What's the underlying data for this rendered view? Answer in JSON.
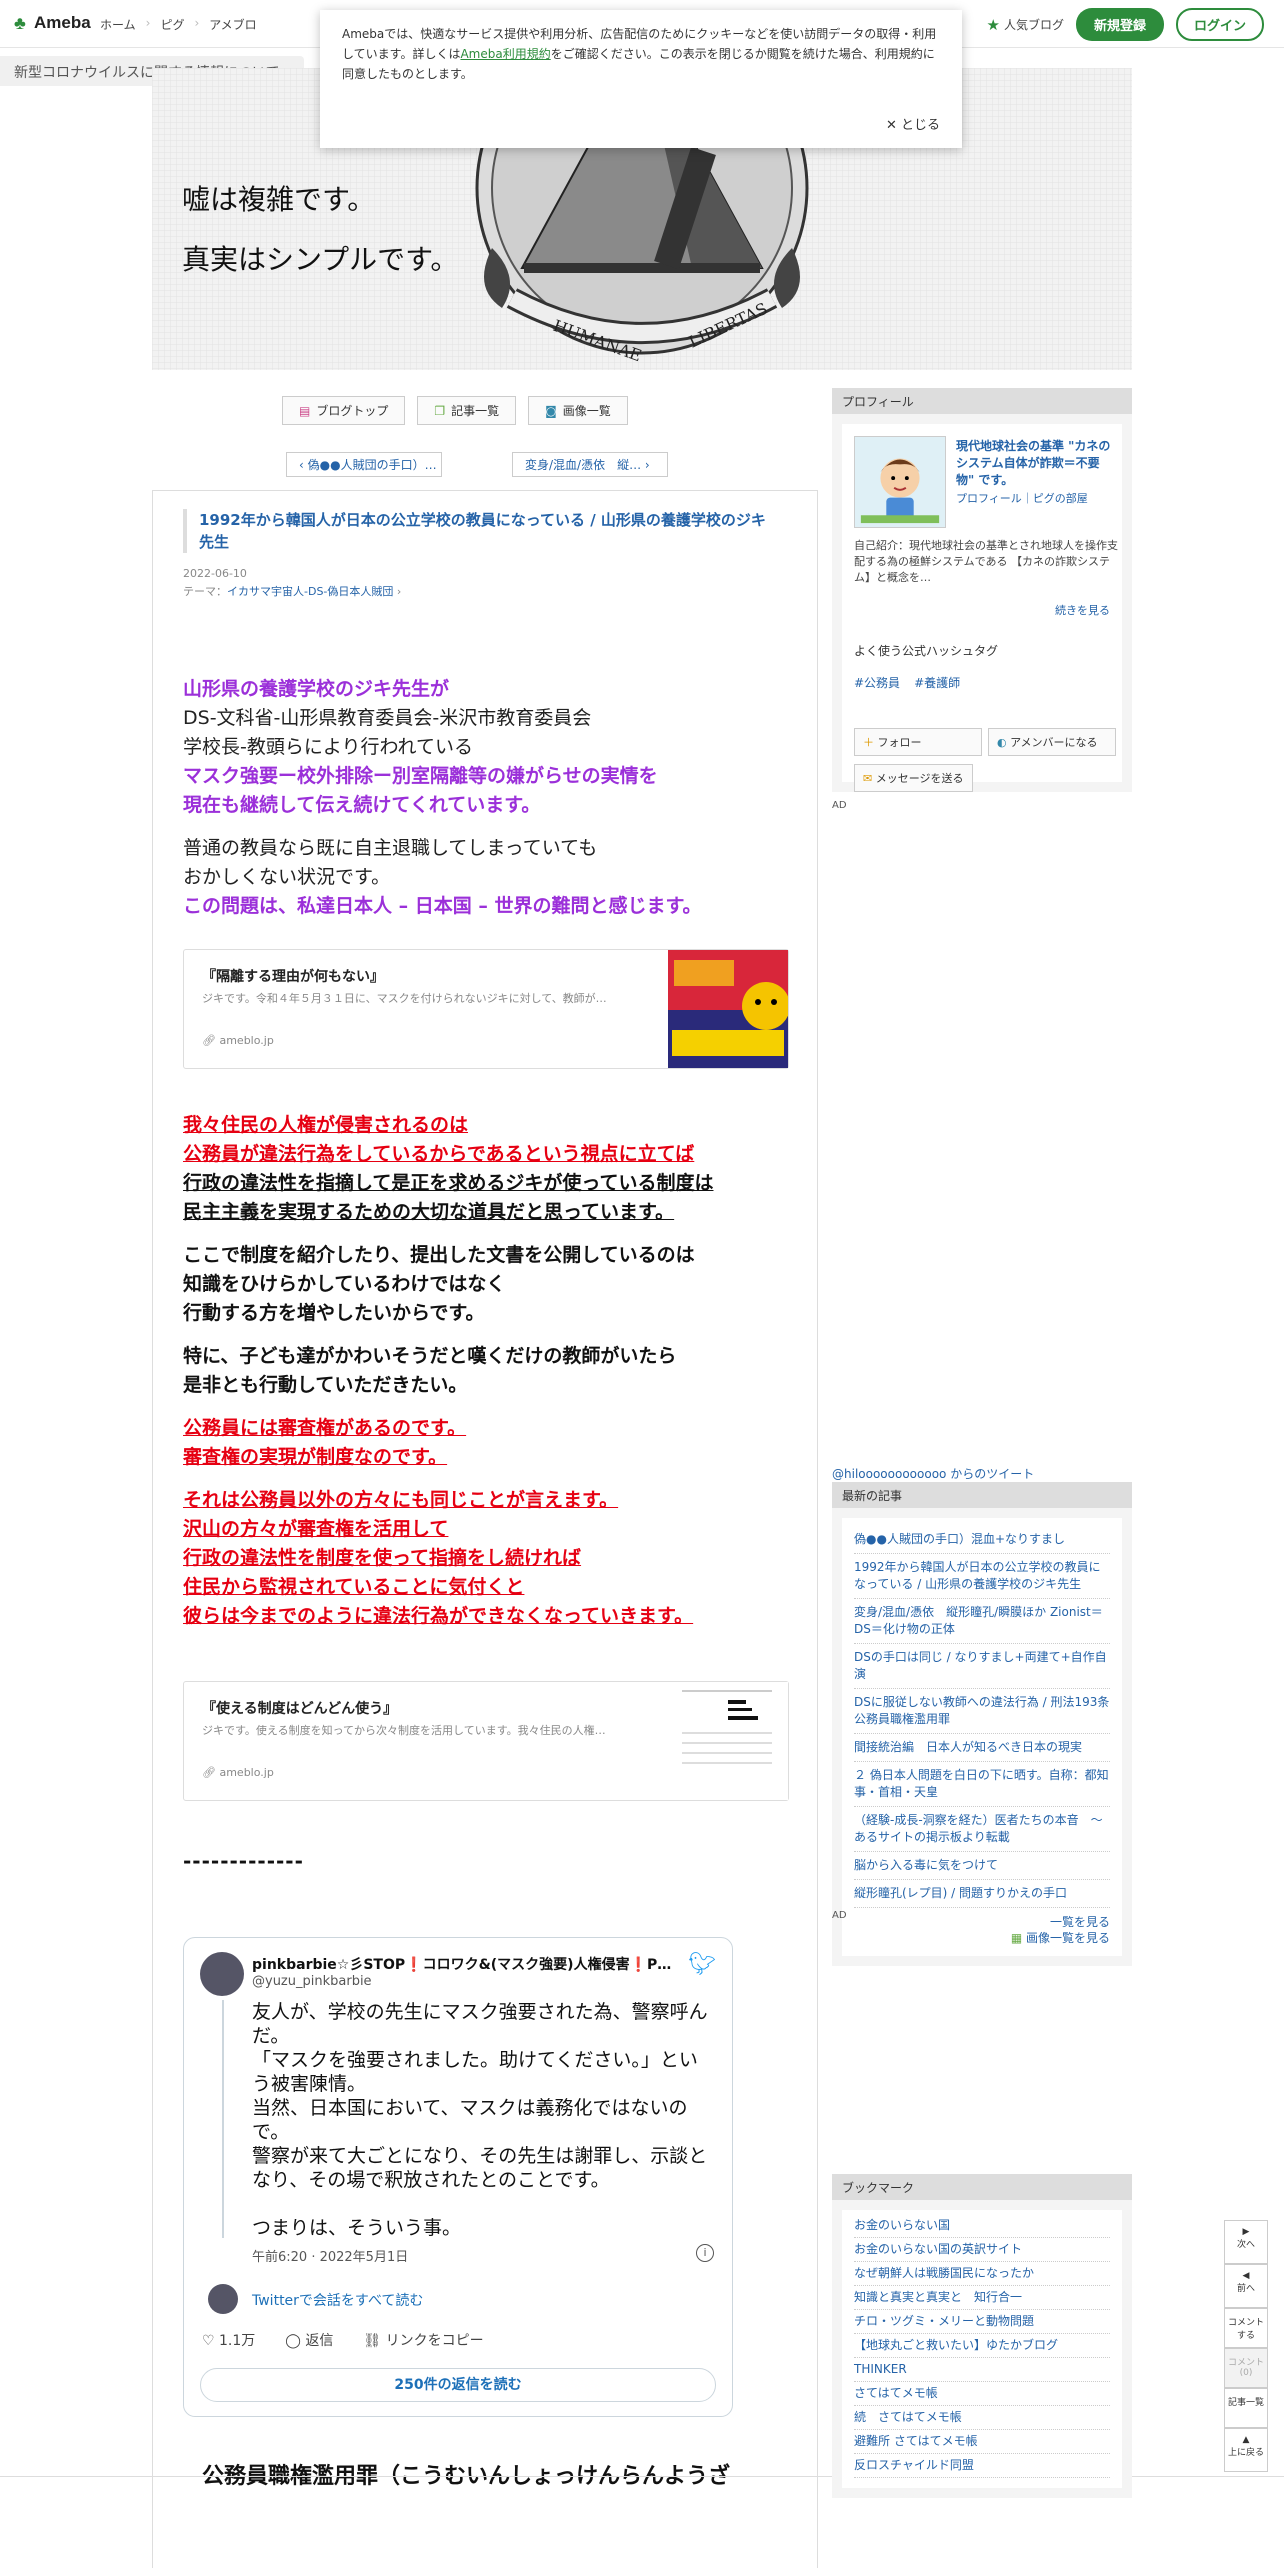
{
  "header": {
    "logo": "Ameba",
    "nav": [
      "ホーム",
      "ピグ",
      "アメブロ"
    ],
    "popular": "人気ブログ",
    "register": "新規登録",
    "login": "ログイン"
  },
  "crumb": "新型コロナウイルスに関する情報について",
  "cookie": {
    "text1": "Amebaでは、快適なサービス提供や利用分析、広告配信のためにクッキーなどを使い訪問データの取得・利用しています。詳しくは",
    "link": "Ameba利用規約",
    "text2": "をご確認ください。この表示を閉じるか閲覧を続けた場合、利用規約に同意したものとします。",
    "close": "とじる"
  },
  "banner": {
    "line1": "嘘は複雑です。",
    "line2": "真実はシンプルです。"
  },
  "blognav": [
    "ブログトップ",
    "記事一覧",
    "画像一覧"
  ],
  "pager": {
    "prev": "偽●●人賊団の手口）…",
    "next": "変身/混血/憑依　縦…"
  },
  "article": {
    "title": "1992年から韓国人が日本の公立学校の教員になっている / 山形県の養護学校のジキ先生",
    "date": "2022-06-10",
    "theme_label": "テーマ：",
    "theme": "イカサマ宇宙人-DS-偽日本人賊団",
    "p1": [
      "山形県の養護学校のジキ先生が",
      "DS-文科省-山形県教育委員会-米沢市教育委員会",
      "学校長-教頭らにより行われている",
      "マスク強要ー校外排除ー別室隔離等の嫌がらせの実情を",
      "現在も継続して伝え続けてくれています。"
    ],
    "p2": [
      "普通の教員なら既に自主退職してしまっていても",
      "おかしくない状況です。",
      "この問題は、私達日本人 – 日本国 – 世界の難問と感じます。"
    ],
    "card1": {
      "title": "『隔離する理由が何もない』",
      "desc": "ジキです。令和４年５月３１日に、マスクを付けられないジキに対して、教師が…",
      "site": "ameblo.jp"
    },
    "p3": [
      "我々住民の人権が侵害されるのは",
      "公務員が違法行為をしているからであるという視点に立てば",
      "行政の違法性を指摘して是正を求めるジキが使っている制度は",
      "民主主義を実現するための大切な道具だと思っています。"
    ],
    "p4": [
      "ここで制度を紹介したり、提出した文書を公開しているのは",
      "知識をひけらかしているわけではなく",
      "行動する方を増やしたいからです。"
    ],
    "p5": [
      "特に、子ども達がかわいそうだと嘆くだけの教師がいたら",
      "是非とも行動していただきたい。"
    ],
    "p6": [
      "公務員には審査権があるのです。",
      "審査権の実現が制度なのです。"
    ],
    "p7": [
      "それは公務員以外の方々にも同じことが言えます。",
      "沢山の方々が審査権を活用して",
      "行政の違法性を制度を使って指摘をし続ければ",
      "住民から監視されていることに気付くと",
      "彼らは今までのように違法行為ができなくなっていきます。"
    ],
    "card2": {
      "title": "『使える制度はどんどん使う』",
      "desc": "ジキです。使える制度を知ってから次々制度を活用しています。我々住民の人権…",
      "site": "ameblo.jp"
    },
    "dashes": "-------------",
    "bottom": "公務員職権濫用罪（こうむいんしょっけんらんようざ"
  },
  "tweet": {
    "name": "pinkbarbie☆彡STOP❗コロワク&(マスク強要)人権侵害❗P…",
    "handle": "@yuzu_pinkbarbie",
    "text": "友人が、学校の先生にマスク強要された為、警察呼んだ。\n「マスクを強要されました。助けてください。」という被害陳情。\n当然、日本国において、マスクは義務化ではないので。\n警察が来て大ごとになり、その先生は謝罪し、示談となり、その場で釈放されたとのことです。\n\nつまりは、そういう事。",
    "time": "午前6:20 · 2022年5月1日",
    "conv": "Twitterで会話をすべて読む",
    "likes": "1.1万",
    "reply": "返信",
    "copy": "リンクをコピー",
    "replies": "250件の返信を読む"
  },
  "profile": {
    "head": "プロフィール",
    "name": "現代地球社会の基準 \"カネのシステム自体が詐欺＝不要物\" です。",
    "links": "プロフィール｜ピグの部屋",
    "intro": "自己紹介：現代地球社会の基準とされ地球人を操作支配する為の極鮮システムである 【カネの詐欺システム】と概念を…",
    "more": "続きを見る",
    "tags_head": "よく使う公式ハッシュタグ",
    "tags": [
      "#公務員",
      "#養護師"
    ],
    "follow": "フォロー",
    "member": "アメンバーになる",
    "message": "メッセージを送る"
  },
  "ad": "AD",
  "tweets_link": "@hiloooooooooooo からのツイート",
  "latest": {
    "head": "最新の記事",
    "items": [
      "偽●●人賊団の手口）混血+なりすまし",
      "1992年から韓国人が日本の公立学校の教員になっている / 山形県の養護学校のジキ先生",
      "変身/混血/憑依　縦形瞳孔/瞬膜ほか Zionist＝DS＝化け物の正体",
      "DSの手口は同じ / なりすまし+両建て+自作自演",
      "DSに服従しない教師への違法行為 / 刑法193条公務員職権濫用罪",
      "間接統治編　日本人が知るべき日本の現実",
      "２ 偽日本人問題を白日の下に晒す。自称：都知事・首相・天皇",
      "（経験-成長-洞察を経た）医者たちの本音　～あるサイトの掲示板より転載",
      "脳から入る毒に気をつけて",
      "縦形瞳孔(レプ目) / 問題すりかえの手口"
    ],
    "more1": "一覧を見る",
    "more2": "画像一覧を見る"
  },
  "bookmark": {
    "head": "ブックマーク",
    "items": [
      "お金のいらない国",
      "お金のいらない国の英訳サイト",
      "なぜ朝鮮人は戦勝国民になったか",
      "知識と真実と真実と　知行合一",
      "チロ・ツグミ・メリーと動物問題",
      "【地球丸ごと救いたい】ゆたかブログ",
      "THINKER",
      "さてはてメモ帳",
      "続　さてはてメモ帳",
      "避難所 さてはてメモ帳",
      "反ロスチャイルド同盟"
    ]
  },
  "floatnav": [
    "次へ",
    "前へ",
    "コメントする",
    "コメント(0)",
    "記事一覧",
    "上に戻る"
  ]
}
